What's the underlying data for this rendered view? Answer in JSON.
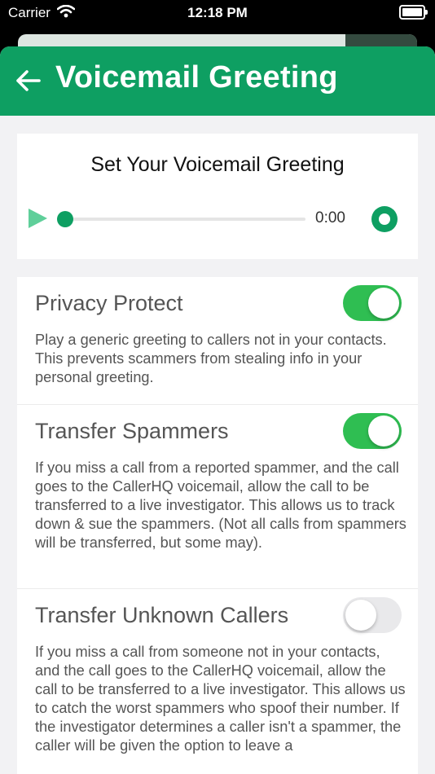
{
  "status_bar": {
    "carrier": "Carrier",
    "time": "12:18 PM"
  },
  "header": {
    "title": "Voicemail Greeting"
  },
  "greeting": {
    "title": "Set Your Voicemail Greeting",
    "time": "0:00",
    "progress": 0
  },
  "settings": [
    {
      "title": "Privacy Protect",
      "enabled": true,
      "description": "Play a generic greeting to callers not in your contacts. This prevents scammers from stealing info in your personal greeting."
    },
    {
      "title": "Transfer Spammers",
      "enabled": true,
      "description": "If you miss a call from a reported spammer, and the call goes to the CallerHQ voicemail, allow the call to be transferred to a live investigator. This allows us to track down & sue the spammers. (Not all calls from spammers will be transferred, but some may)."
    },
    {
      "title": "Transfer Unknown Callers",
      "enabled": false,
      "description": "If you miss a call from someone not in your contacts, and the call goes to the CallerHQ voicemail, allow the call to be transferred to a live investigator. This allows us to catch the worst spammers who spoof their number. If the investigator determines a caller isn't a spammer, the caller will be given the option to leave a"
    }
  ],
  "colors": {
    "brand": "#0e9f62",
    "toggle_on": "#2fbe52",
    "toggle_off": "#e9e9eb"
  }
}
